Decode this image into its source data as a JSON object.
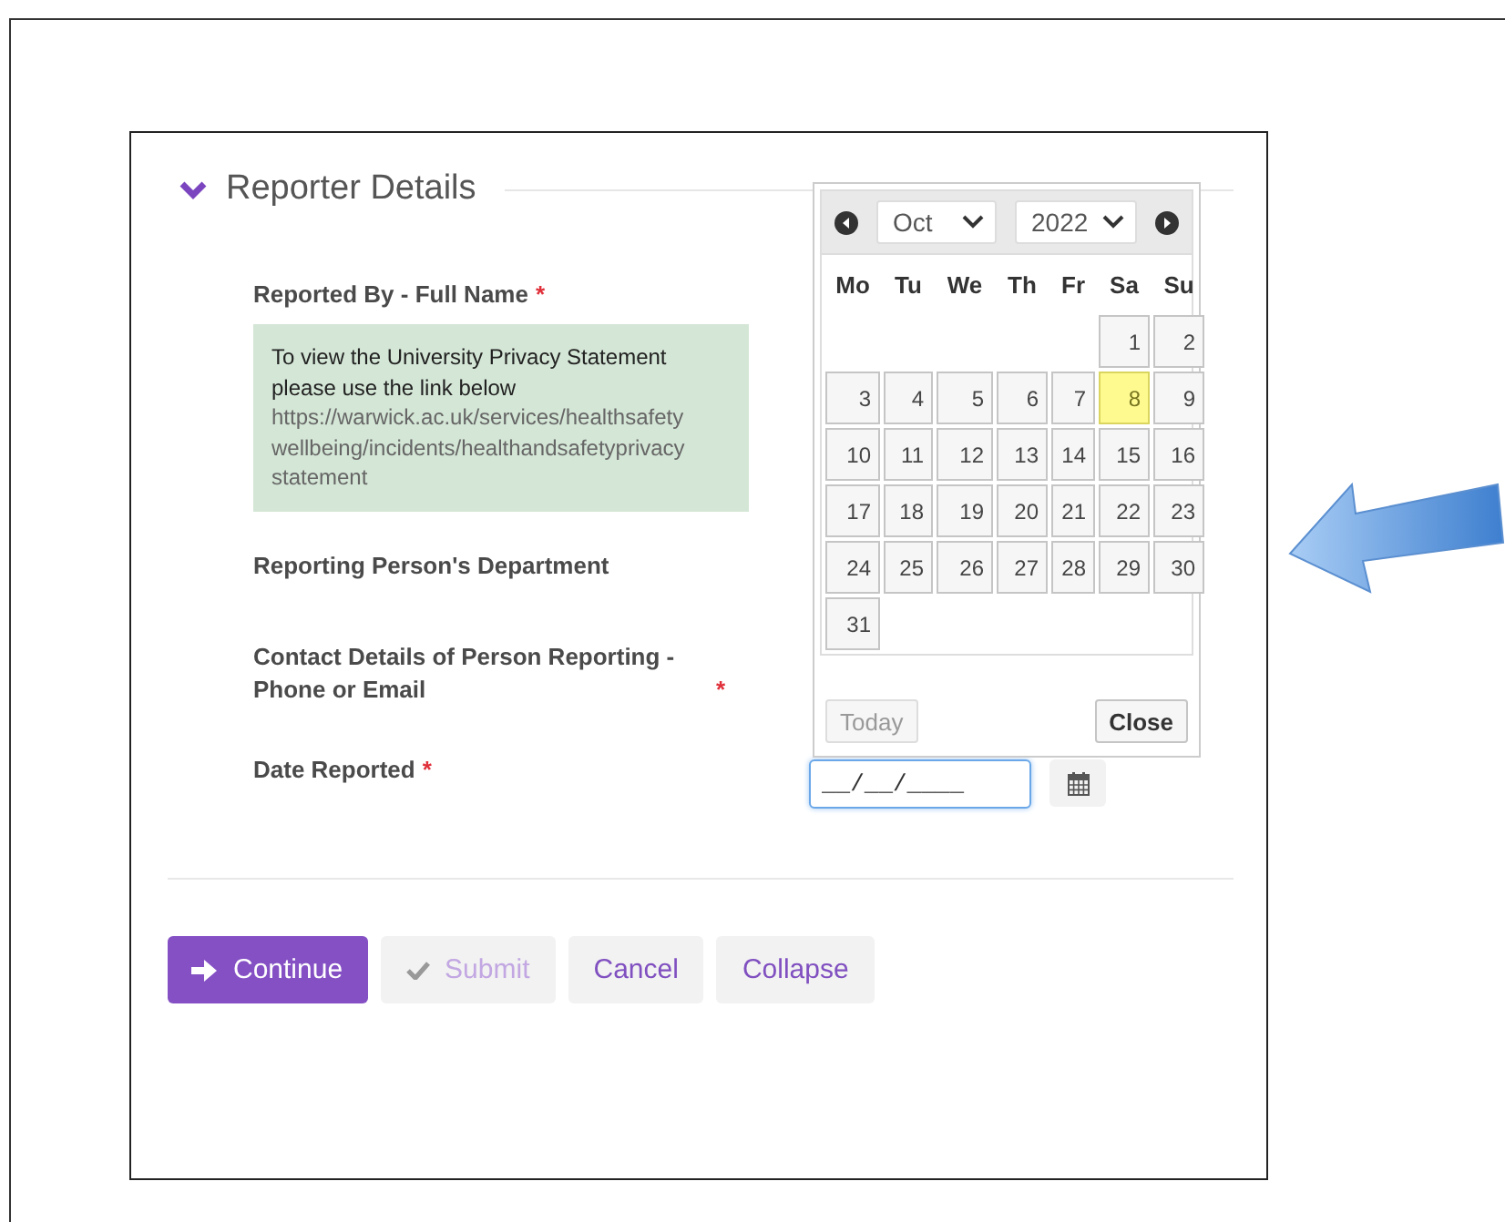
{
  "section": {
    "title": "Reporter Details",
    "expanded": true
  },
  "fields": [
    {
      "label": "Reported By - Full Name",
      "required_mark": "*",
      "kind": "note",
      "note_text": "To view the University Privacy Statement please use the link below",
      "note_link": "https://warwick.ac.uk/services/healthsafety wellbeing/incidents/healthandsafetyprivacy statement"
    },
    {
      "label": "Reporting Person's Department",
      "kind": "plain"
    },
    {
      "label": "Contact Details of Person Reporting - Phone or Email",
      "required_mark": "*",
      "kind": "plain"
    },
    {
      "label": "Date Reported",
      "required_mark": "*",
      "kind": "date",
      "value": "__/__/____"
    }
  ],
  "calendar": {
    "month": "Oct",
    "year": "2022",
    "weekdays": [
      "Mo",
      "Tu",
      "We",
      "Th",
      "Fr",
      "Sa",
      "Su"
    ],
    "weeks": [
      [
        {
          "kind": "blank"
        },
        {
          "kind": "blank"
        },
        {
          "kind": "blank"
        },
        {
          "kind": "blank"
        },
        {
          "kind": "blank"
        },
        {
          "kind": "day",
          "day": "1",
          "today": false
        },
        {
          "kind": "day",
          "day": "2",
          "today": false
        }
      ],
      [
        {
          "kind": "day",
          "day": "3",
          "today": false
        },
        {
          "kind": "day",
          "day": "4",
          "today": false
        },
        {
          "kind": "day",
          "day": "5",
          "today": false
        },
        {
          "kind": "day",
          "day": "6",
          "today": false
        },
        {
          "kind": "day",
          "day": "7",
          "today": false
        },
        {
          "kind": "day",
          "day": "8",
          "today": true
        },
        {
          "kind": "day",
          "day": "9",
          "today": false
        }
      ],
      [
        {
          "kind": "day",
          "day": "10",
          "today": false
        },
        {
          "kind": "day",
          "day": "11",
          "today": false
        },
        {
          "kind": "day",
          "day": "12",
          "today": false
        },
        {
          "kind": "day",
          "day": "13",
          "today": false
        },
        {
          "kind": "day",
          "day": "14",
          "today": false
        },
        {
          "kind": "day",
          "day": "15",
          "today": false
        },
        {
          "kind": "day",
          "day": "16",
          "today": false
        }
      ],
      [
        {
          "kind": "day",
          "day": "17",
          "today": false
        },
        {
          "kind": "day",
          "day": "18",
          "today": false
        },
        {
          "kind": "day",
          "day": "19",
          "today": false
        },
        {
          "kind": "day",
          "day": "20",
          "today": false
        },
        {
          "kind": "day",
          "day": "21",
          "today": false
        },
        {
          "kind": "day",
          "day": "22",
          "today": false
        },
        {
          "kind": "day",
          "day": "23",
          "today": false
        }
      ],
      [
        {
          "kind": "day",
          "day": "24",
          "today": false
        },
        {
          "kind": "day",
          "day": "25",
          "today": false
        },
        {
          "kind": "day",
          "day": "26",
          "today": false
        },
        {
          "kind": "day",
          "day": "27",
          "today": false
        },
        {
          "kind": "day",
          "day": "28",
          "today": false
        },
        {
          "kind": "day",
          "day": "29",
          "today": false
        },
        {
          "kind": "day",
          "day": "30",
          "today": false
        }
      ],
      [
        {
          "kind": "day",
          "day": "31",
          "today": false
        }
      ]
    ],
    "today_button": {
      "label": "Today",
      "disabled": true
    },
    "close_button": {
      "label": "Close",
      "disabled": false
    }
  },
  "buttons": [
    {
      "label": "Continue",
      "kind": "primary",
      "disabled": false
    },
    {
      "label": "Submit",
      "kind": "check",
      "disabled": true
    },
    {
      "label": "Cancel",
      "kind": "plain",
      "disabled": false
    },
    {
      "label": "Collapse",
      "kind": "plain",
      "disabled": false
    }
  ]
}
